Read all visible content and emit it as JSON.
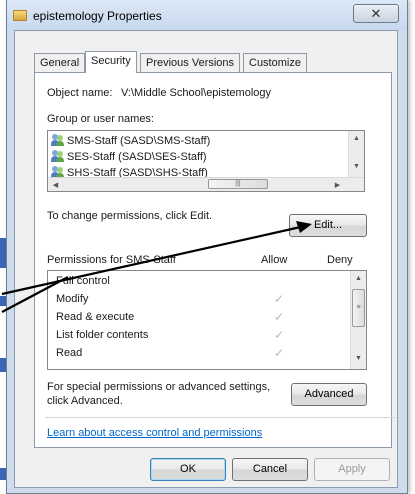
{
  "window": {
    "title": "epistemology Properties",
    "close_glyph": "✕"
  },
  "tabs": [
    {
      "label": "General"
    },
    {
      "label": "Security",
      "active": true
    },
    {
      "label": "Previous Versions"
    },
    {
      "label": "Customize"
    }
  ],
  "security": {
    "object_name_label": "Object name:",
    "object_name_value": "V:\\Middle School\\epistemology",
    "groups_label": "Group or user names:",
    "groups": [
      {
        "name": "SMS-Staff (SASD\\SMS-Staff)",
        "icon": "user-group-icon"
      },
      {
        "name": "SES-Staff (SASD\\SES-Staff)",
        "icon": "user-group-icon"
      },
      {
        "name": "SHS-Staff (SASD\\SHS-Staff)",
        "icon": "user-group-icon"
      }
    ],
    "change_permissions_text": "To change permissions, click Edit.",
    "edit_button": "Edit...",
    "permissions_for_label": "Permissions for SMS-Staff",
    "allow_header": "Allow",
    "deny_header": "Deny",
    "permissions": [
      {
        "name": "Full control",
        "allow": false
      },
      {
        "name": "Modify",
        "allow": true
      },
      {
        "name": "Read & execute",
        "allow": true
      },
      {
        "name": "List folder contents",
        "allow": true
      },
      {
        "name": "Read",
        "allow": true
      }
    ],
    "special_permissions_text_line1": "For special permissions or advanced settings,",
    "special_permissions_text_line2": "click Advanced.",
    "advanced_button": "Advanced",
    "learn_link": "Learn about access control and permissions"
  },
  "footer": {
    "ok": "OK",
    "cancel": "Cancel",
    "apply": "Apply"
  },
  "colors": {
    "titlebar": "#cfdcec",
    "link": "#0066cc",
    "check": "#b8b8b8"
  }
}
